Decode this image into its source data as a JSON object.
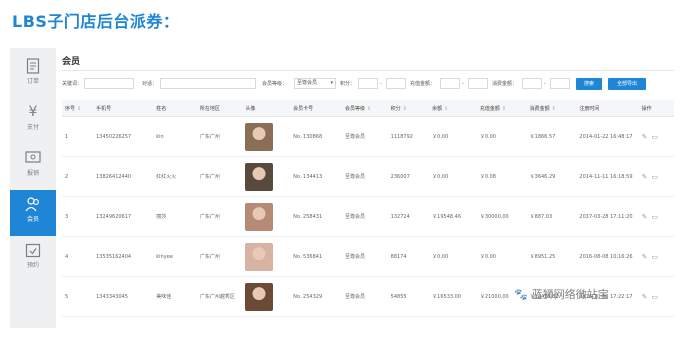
{
  "heading": "LBS子门店后台派券：",
  "sidebar": {
    "items": [
      {
        "label": "订单",
        "icon": "document-icon"
      },
      {
        "label": "支付",
        "icon": "yen-icon"
      },
      {
        "label": "报销",
        "icon": "reimburse-icon"
      },
      {
        "label": "会员",
        "icon": "member-icon",
        "active": true
      },
      {
        "label": "预约",
        "icon": "calendar-check-icon"
      }
    ]
  },
  "page_title": "会员",
  "filters": {
    "keyword_label": "关键词：",
    "staff_label": "对话：",
    "level_label": "会员等级：",
    "level_value": "至尊会员",
    "points_label": "积分：",
    "recharge_label": "充值金额：",
    "consume_label": "消费金额：",
    "range_sep": "-",
    "search_button": "搜索",
    "export_button": "全部导出"
  },
  "table": {
    "columns": [
      "序号",
      "手机号",
      "姓名",
      "所在地区",
      "头像",
      "会员卡号",
      "会员等级",
      "积分",
      "余额",
      "充值金额",
      "消费金额",
      "注册时间",
      "操作"
    ],
    "rows": [
      {
        "no": "1",
        "phone": "13450226257",
        "name": "kin",
        "region": "广东广州",
        "card": "No. 130868",
        "level": "至尊会员",
        "points": "1118792",
        "balance": "￥0.00",
        "recharge": "￥0.00",
        "consume": "￥1866.57",
        "time": "2014-01-22 16:48:17"
      },
      {
        "no": "2",
        "phone": "13826412440",
        "name": "红红火火",
        "region": "广东广州",
        "card": "No. 134413",
        "level": "至尊会员",
        "points": "236007",
        "balance": "￥0.00",
        "recharge": "￥0.08",
        "consume": "￥3646.29",
        "time": "2014-11-11 16:18:59"
      },
      {
        "no": "3",
        "phone": "13249620617",
        "name": "丽莎",
        "region": "广东广州",
        "card": "No. 258431",
        "level": "至尊会员",
        "points": "132724",
        "balance": "￥19548.46",
        "recharge": "￥30000.00",
        "consume": "￥887.03",
        "time": "2017-03-28 17:11:20"
      },
      {
        "no": "4",
        "phone": "13535162404",
        "name": "kinyee",
        "region": "广东广州",
        "card": "No. 536841",
        "level": "至尊会员",
        "points": "88174",
        "balance": "￥0.00",
        "recharge": "￥0.00",
        "consume": "￥8951.25",
        "time": "2016-08-08 10:16:26"
      },
      {
        "no": "5",
        "phone": "1343343045",
        "name": "美味佳",
        "region": "广东广州越秀区",
        "card": "No. 254329",
        "level": "至尊会员",
        "points": "54855",
        "balance": "￥16533.00",
        "recharge": "￥21000.00",
        "consume": "￥12436.81",
        "time": "2016-10-09 17:22:17"
      }
    ]
  },
  "watermark": "蓝狮网络微站宝",
  "colors": {
    "accent": "#1f86d6",
    "sidebar_bg": "#eef0f1",
    "header_bg": "#f4f6f8"
  }
}
